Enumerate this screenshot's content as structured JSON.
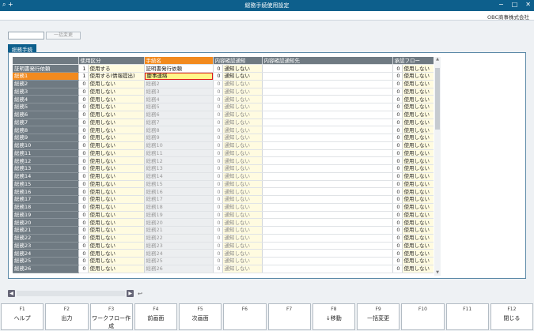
{
  "window": {
    "title": "総務手続使用設定",
    "company": "OBC商事株式会社"
  },
  "toolbar": {
    "icon_zoom": "⌕",
    "icon_plus": "+",
    "button_label": "一括変更"
  },
  "tab": {
    "label": "総務手続"
  },
  "columns": [
    "使用区分",
    "手続名",
    "内容確認通知",
    "内容確認通知先",
    "承認フロー"
  ],
  "rows": [
    {
      "head": "証明書発行依頼",
      "kubun_no": "1",
      "kubun": "使用する",
      "name": "証明書発行依頼",
      "notify_no": "0",
      "notify": "通知しない",
      "dest": "",
      "flow_no": "0",
      "flow": "使用しない"
    },
    {
      "head": "総務1",
      "kubun_no": "1",
      "kubun": "使用する(情報提出)",
      "name": "慶事連絡",
      "notify_no": "0",
      "notify": "通知しない",
      "dest": "",
      "flow_no": "0",
      "flow": "使用しない"
    },
    {
      "head": "総務2",
      "kubun_no": "0",
      "kubun": "使用しない",
      "name": "総務2",
      "notify_no": "0",
      "notify": "通知しない",
      "dest": "",
      "flow_no": "0",
      "flow": "使用しない"
    },
    {
      "head": "総務3",
      "kubun_no": "0",
      "kubun": "使用しない",
      "name": "総務3",
      "notify_no": "0",
      "notify": "通知しない",
      "dest": "",
      "flow_no": "0",
      "flow": "使用しない"
    },
    {
      "head": "総務4",
      "kubun_no": "0",
      "kubun": "使用しない",
      "name": "総務4",
      "notify_no": "0",
      "notify": "通知しない",
      "dest": "",
      "flow_no": "0",
      "flow": "使用しない"
    },
    {
      "head": "総務5",
      "kubun_no": "0",
      "kubun": "使用しない",
      "name": "総務5",
      "notify_no": "0",
      "notify": "通知しない",
      "dest": "",
      "flow_no": "0",
      "flow": "使用しない"
    },
    {
      "head": "総務6",
      "kubun_no": "0",
      "kubun": "使用しない",
      "name": "総務6",
      "notify_no": "0",
      "notify": "通知しない",
      "dest": "",
      "flow_no": "0",
      "flow": "使用しない"
    },
    {
      "head": "総務7",
      "kubun_no": "0",
      "kubun": "使用しない",
      "name": "総務7",
      "notify_no": "0",
      "notify": "通知しない",
      "dest": "",
      "flow_no": "0",
      "flow": "使用しない"
    },
    {
      "head": "総務8",
      "kubun_no": "0",
      "kubun": "使用しない",
      "name": "総務8",
      "notify_no": "0",
      "notify": "通知しない",
      "dest": "",
      "flow_no": "0",
      "flow": "使用しない"
    },
    {
      "head": "総務9",
      "kubun_no": "0",
      "kubun": "使用しない",
      "name": "総務9",
      "notify_no": "0",
      "notify": "通知しない",
      "dest": "",
      "flow_no": "0",
      "flow": "使用しない"
    },
    {
      "head": "総務10",
      "kubun_no": "0",
      "kubun": "使用しない",
      "name": "総務10",
      "notify_no": "0",
      "notify": "通知しない",
      "dest": "",
      "flow_no": "0",
      "flow": "使用しない"
    },
    {
      "head": "総務11",
      "kubun_no": "0",
      "kubun": "使用しない",
      "name": "総務11",
      "notify_no": "0",
      "notify": "通知しない",
      "dest": "",
      "flow_no": "0",
      "flow": "使用しない"
    },
    {
      "head": "総務12",
      "kubun_no": "0",
      "kubun": "使用しない",
      "name": "総務12",
      "notify_no": "0",
      "notify": "通知しない",
      "dest": "",
      "flow_no": "0",
      "flow": "使用しない"
    },
    {
      "head": "総務13",
      "kubun_no": "0",
      "kubun": "使用しない",
      "name": "総務13",
      "notify_no": "0",
      "notify": "通知しない",
      "dest": "",
      "flow_no": "0",
      "flow": "使用しない"
    },
    {
      "head": "総務14",
      "kubun_no": "0",
      "kubun": "使用しない",
      "name": "総務14",
      "notify_no": "0",
      "notify": "通知しない",
      "dest": "",
      "flow_no": "0",
      "flow": "使用しない"
    },
    {
      "head": "総務15",
      "kubun_no": "0",
      "kubun": "使用しない",
      "name": "総務15",
      "notify_no": "0",
      "notify": "通知しない",
      "dest": "",
      "flow_no": "0",
      "flow": "使用しない"
    },
    {
      "head": "総務16",
      "kubun_no": "0",
      "kubun": "使用しない",
      "name": "総務16",
      "notify_no": "0",
      "notify": "通知しない",
      "dest": "",
      "flow_no": "0",
      "flow": "使用しない"
    },
    {
      "head": "総務17",
      "kubun_no": "0",
      "kubun": "使用しない",
      "name": "総務17",
      "notify_no": "0",
      "notify": "通知しない",
      "dest": "",
      "flow_no": "0",
      "flow": "使用しない"
    },
    {
      "head": "総務18",
      "kubun_no": "0",
      "kubun": "使用しない",
      "name": "総務18",
      "notify_no": "0",
      "notify": "通知しない",
      "dest": "",
      "flow_no": "0",
      "flow": "使用しない"
    },
    {
      "head": "総務19",
      "kubun_no": "0",
      "kubun": "使用しない",
      "name": "総務19",
      "notify_no": "0",
      "notify": "通知しない",
      "dest": "",
      "flow_no": "0",
      "flow": "使用しない"
    },
    {
      "head": "総務20",
      "kubun_no": "0",
      "kubun": "使用しない",
      "name": "総務20",
      "notify_no": "0",
      "notify": "通知しない",
      "dest": "",
      "flow_no": "0",
      "flow": "使用しない"
    },
    {
      "head": "総務21",
      "kubun_no": "0",
      "kubun": "使用しない",
      "name": "総務21",
      "notify_no": "0",
      "notify": "通知しない",
      "dest": "",
      "flow_no": "0",
      "flow": "使用しない"
    },
    {
      "head": "総務22",
      "kubun_no": "0",
      "kubun": "使用しない",
      "name": "総務22",
      "notify_no": "0",
      "notify": "通知しない",
      "dest": "",
      "flow_no": "0",
      "flow": "使用しない"
    },
    {
      "head": "総務23",
      "kubun_no": "0",
      "kubun": "使用しない",
      "name": "総務23",
      "notify_no": "0",
      "notify": "通知しない",
      "dest": "",
      "flow_no": "0",
      "flow": "使用しない"
    },
    {
      "head": "総務24",
      "kubun_no": "0",
      "kubun": "使用しない",
      "name": "総務24",
      "notify_no": "0",
      "notify": "通知しない",
      "dest": "",
      "flow_no": "0",
      "flow": "使用しない"
    },
    {
      "head": "総務25",
      "kubun_no": "0",
      "kubun": "使用しない",
      "name": "総務25",
      "notify_no": "0",
      "notify": "通知しない",
      "dest": "",
      "flow_no": "0",
      "flow": "使用しない"
    },
    {
      "head": "総務26",
      "kubun_no": "0",
      "kubun": "使用しない",
      "name": "総務26",
      "notify_no": "0",
      "notify": "通知しない",
      "dest": "",
      "flow_no": "0",
      "flow": "使用しない"
    }
  ],
  "fkeys": [
    {
      "key": "F1",
      "label": "ヘルプ"
    },
    {
      "key": "F2",
      "label": "出力"
    },
    {
      "key": "F3",
      "label": "ワークフロー作成"
    },
    {
      "key": "F4",
      "label": "前画面"
    },
    {
      "key": "F5",
      "label": "次画面"
    },
    {
      "key": "F6",
      "label": ""
    },
    {
      "key": "F7",
      "label": ""
    },
    {
      "key": "F8",
      "label": "↓移動"
    },
    {
      "key": "F9",
      "label": "一括変更"
    },
    {
      "key": "F10",
      "label": ""
    },
    {
      "key": "F11",
      "label": ""
    },
    {
      "key": "F12",
      "label": "閉じる"
    }
  ],
  "colors": {
    "titlebar": "#0d5f8c",
    "accent": "#f28a1e",
    "highlight_border": "#e01919",
    "highlight_fill": "#fff78a"
  }
}
